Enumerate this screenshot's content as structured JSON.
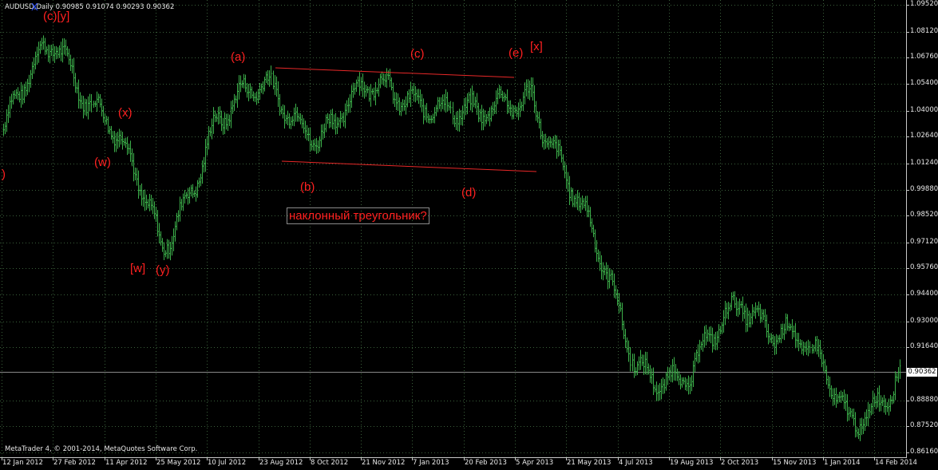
{
  "chart": {
    "header": "AUDUSD,Daily  0.90985 0.91074 0.90293 0.90362",
    "copyright": "MetaTrader 4, © 2001-2014, MetaQuotes Software Corp.",
    "current_price": "0.90362",
    "colors": {
      "background": "#000000",
      "grid": "#3a5f3a",
      "bars": "#3cb04a",
      "annotations": "#ff2020",
      "trendlines": "#e82828",
      "axis_text": "#e8e8e8"
    }
  },
  "price_axis": {
    "labels": [
      "1.09520",
      "1.08120",
      "1.06760",
      "1.05400",
      "1.04000",
      "1.02640",
      "1.01240",
      "0.99880",
      "0.98520",
      "0.97120",
      "0.95760",
      "0.94400",
      "0.93000",
      "0.91640",
      "0.90362",
      "0.88880",
      "0.87520",
      "0.86160"
    ]
  },
  "time_axis": {
    "labels": [
      "12 Jan 2012",
      "27 Feb 2012",
      "11 Apr 2012",
      "25 May 2012",
      "10 Jul 2012",
      "23 Aug 2012",
      "8 Oct 2012",
      "21 Nov 2012",
      "7 Jan 2013",
      "20 Feb 2013",
      "5 Apr 2013",
      "21 May 2013",
      "4 Jul 2013",
      "19 Aug 2013",
      "2 Oct 2013",
      "15 Nov 2013",
      "1 Jan 2014",
      "14 Feb 2014"
    ]
  },
  "annotations": {
    "wave_labels": [
      "(c)[y]",
      "X",
      "(x)",
      "(w)",
      "[w]",
      "(y)",
      "(a)",
      "(b)",
      "(c)",
      "(d)",
      "(e)",
      "[x]",
      ")"
    ],
    "note": "наклонный треугольник?"
  },
  "chart_data": {
    "type": "line",
    "title": "AUDUSD,Daily",
    "x_range": [
      "12 Jan 2012",
      "14 Feb 2014"
    ],
    "ylim": [
      0.8616,
      1.0952
    ],
    "grid": true,
    "series": [
      {
        "x": [
          "12 Jan 2012",
          "27 Feb 2012",
          "11 Apr 2012",
          "25 May 2012",
          "10 Jul 2012",
          "23 Aug 2012",
          "8 Oct 2012",
          "21 Nov 2012",
          "7 Jan 2013",
          "20 Feb 2013",
          "5 Apr 2013",
          "21 May 2013",
          "4 Jul 2013",
          "19 Aug 2013",
          "2 Oct 2013",
          "15 Nov 2013",
          "1 Jan 2014",
          "14 Feb 2014"
        ],
        "values": [
          1.03,
          1.075,
          1.038,
          0.963,
          1.038,
          1.047,
          1.033,
          1.047,
          1.051,
          1.03,
          1.055,
          0.98,
          0.913,
          0.895,
          0.945,
          0.92,
          0.88,
          0.903
        ]
      }
    ]
  }
}
